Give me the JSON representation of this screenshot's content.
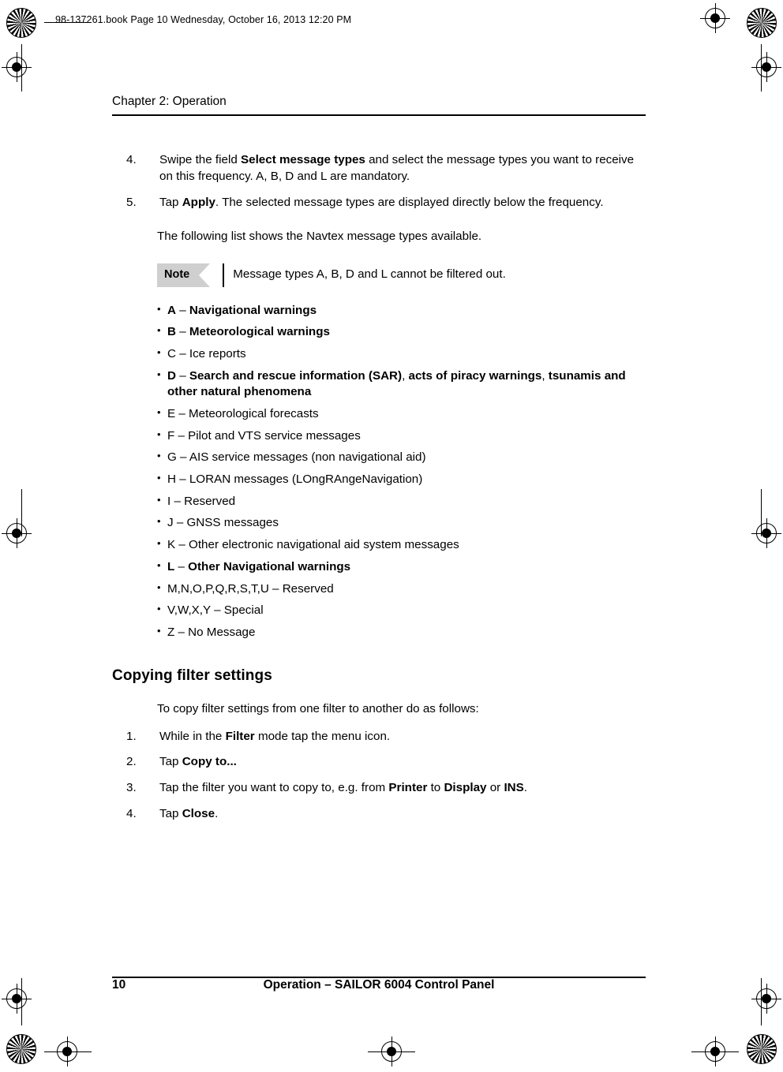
{
  "page": {
    "filestamp": "98-137261.book  Page 10  Wednesday, October 16, 2013  12:20 PM",
    "chapter": "Chapter 2:  Operation",
    "footer_page_number": "10",
    "footer_title": "Operation – SAILOR 6004 Control Panel"
  },
  "steps_top": [
    {
      "number": "4.",
      "parts": [
        {
          "text": "Swipe the field ",
          "bold": false
        },
        {
          "text": "Select message types",
          "bold": true
        },
        {
          "text": " and select the message types you want to receive on this frequency. A, B, D and L are mandatory.",
          "bold": false
        }
      ]
    },
    {
      "number": "5.",
      "parts": [
        {
          "text": "Tap ",
          "bold": false
        },
        {
          "text": "Apply",
          "bold": true
        },
        {
          "text": ". The selected message types are displayed directly below the frequency.",
          "bold": false
        }
      ]
    }
  ],
  "intro_paragraph": "The following list shows the Navtex message types available.",
  "note": {
    "label": "Note",
    "text": "Message types A, B, D and L cannot be filtered out."
  },
  "message_types": [
    {
      "parts": [
        {
          "text": "A",
          "bold": true
        },
        {
          "text": " – ",
          "bold": false
        },
        {
          "text": "Navigational warnings",
          "bold": true
        }
      ]
    },
    {
      "parts": [
        {
          "text": "B",
          "bold": true
        },
        {
          "text": " – ",
          "bold": false
        },
        {
          "text": "Meteorological warnings",
          "bold": true
        }
      ]
    },
    {
      "parts": [
        {
          "text": "C – Ice reports",
          "bold": false
        }
      ]
    },
    {
      "parts": [
        {
          "text": "D",
          "bold": true
        },
        {
          "text": " – ",
          "bold": false
        },
        {
          "text": "Search and rescue information (SAR)",
          "bold": true
        },
        {
          "text": ", ",
          "bold": false
        },
        {
          "text": "acts of piracy warnings",
          "bold": true
        },
        {
          "text": ", ",
          "bold": false
        },
        {
          "text": "tsunamis and other natural phenomena",
          "bold": true
        }
      ]
    },
    {
      "parts": [
        {
          "text": "E – Meteorological forecasts",
          "bold": false
        }
      ]
    },
    {
      "parts": [
        {
          "text": "F – Pilot and VTS service messages",
          "bold": false
        }
      ]
    },
    {
      "parts": [
        {
          "text": "G – AIS service messages (non navigational aid)",
          "bold": false
        }
      ]
    },
    {
      "parts": [
        {
          "text": "H – LORAN messages (LOngRAngeNavigation)",
          "bold": false
        }
      ]
    },
    {
      "parts": [
        {
          "text": "I – Reserved",
          "bold": false
        }
      ]
    },
    {
      "parts": [
        {
          "text": "J – GNSS messages",
          "bold": false
        }
      ]
    },
    {
      "parts": [
        {
          "text": "K – Other electronic navigational aid system messages",
          "bold": false
        }
      ]
    },
    {
      "parts": [
        {
          "text": "L",
          "bold": true
        },
        {
          "text": " – ",
          "bold": false
        },
        {
          "text": "Other Navigational warnings",
          "bold": true
        }
      ]
    },
    {
      "parts": [
        {
          "text": "M,N,O,P,Q,R,S,T,U – Reserved",
          "bold": false
        }
      ]
    },
    {
      "parts": [
        {
          "text": "V,W,X,Y – Special",
          "bold": false
        }
      ]
    },
    {
      "parts": [
        {
          "text": "Z – No Message",
          "bold": false
        }
      ]
    }
  ],
  "section": {
    "heading": "Copying filter settings",
    "intro": "To copy filter settings from one filter to another do as follows:",
    "steps": [
      {
        "number": "1.",
        "parts": [
          {
            "text": "While in the ",
            "bold": false
          },
          {
            "text": "Filter",
            "bold": true
          },
          {
            "text": " mode tap the menu icon.",
            "bold": false
          }
        ]
      },
      {
        "number": "2.",
        "parts": [
          {
            "text": "Tap ",
            "bold": false
          },
          {
            "text": "Copy to...",
            "bold": true
          }
        ]
      },
      {
        "number": "3.",
        "parts": [
          {
            "text": "Tap the filter you want to copy to, e.g. from ",
            "bold": false
          },
          {
            "text": "Printer",
            "bold": true
          },
          {
            "text": " to ",
            "bold": false
          },
          {
            "text": "Display",
            "bold": true
          },
          {
            "text": " or ",
            "bold": false
          },
          {
            "text": "INS",
            "bold": true
          },
          {
            "text": ".",
            "bold": false
          }
        ]
      },
      {
        "number": "4.",
        "parts": [
          {
            "text": "Tap ",
            "bold": false
          },
          {
            "text": "Close",
            "bold": true
          },
          {
            "text": ".",
            "bold": false
          }
        ]
      }
    ]
  }
}
